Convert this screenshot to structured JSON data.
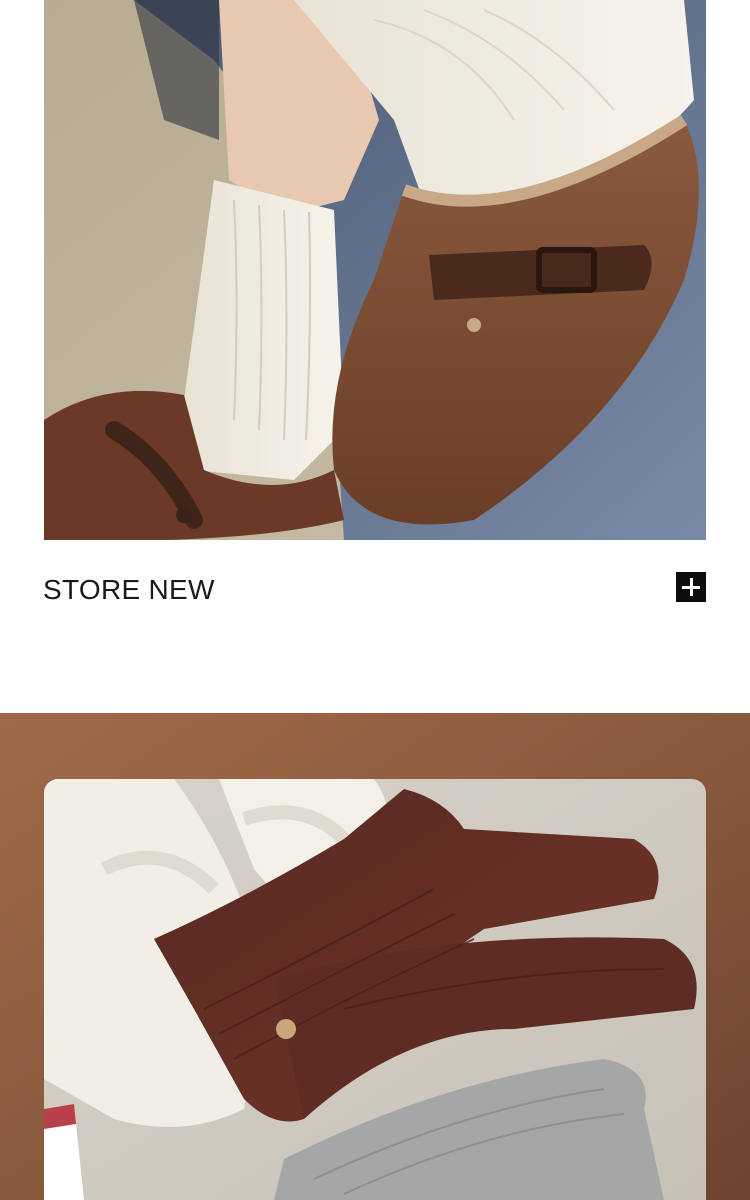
{
  "section": {
    "title": "STORE NEW",
    "expand_icon": "plus-icon"
  },
  "images": {
    "top": "photo-clogs-cable-socks",
    "bottom": "photo-brown-socks-slippers"
  },
  "colors": {
    "accent": "#0d0d0d",
    "band": "#8a5a3d"
  }
}
